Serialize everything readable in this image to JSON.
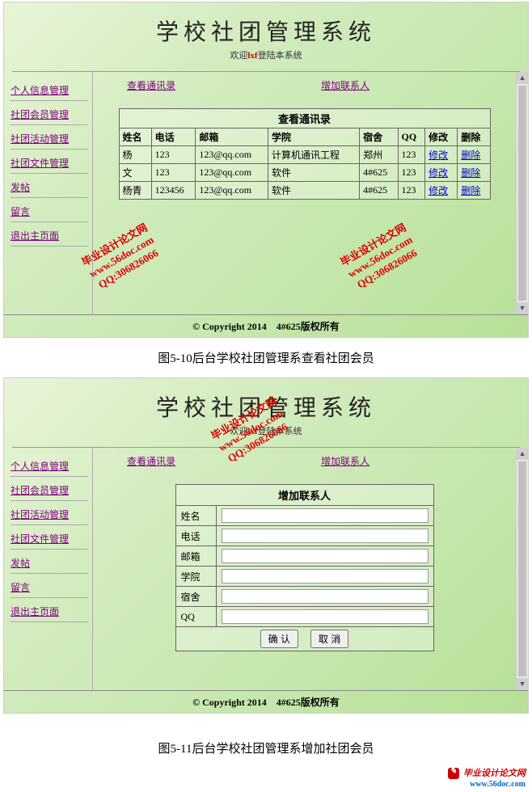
{
  "app": {
    "title": "学校社团管理系统",
    "welcome_prefix": "欢迎",
    "username": "lxf",
    "welcome_suffix": "登陆本系统"
  },
  "sidebar": {
    "items": [
      {
        "label": "个人信息管理"
      },
      {
        "label": "社团会员管理"
      },
      {
        "label": "社团活动管理"
      },
      {
        "label": "社团文件管理"
      },
      {
        "label": "发帖"
      },
      {
        "label": "留言"
      },
      {
        "label": "退出主页面"
      }
    ]
  },
  "tabs": {
    "view": "查看通讯录",
    "add": "增加联系人"
  },
  "view_table": {
    "title": "查看通讯录",
    "headers": {
      "name": "姓名",
      "phone": "电话",
      "email": "邮箱",
      "college": "学院",
      "dorm": "宿舍",
      "qq": "QQ",
      "edit": "修改",
      "del": "删除"
    },
    "rows": [
      {
        "name": "杨",
        "phone": "123",
        "email": "123@qq.com",
        "college": "计算机通讯工程",
        "dorm": "郑州",
        "qq": "123",
        "edit": "修改",
        "del": "删除"
      },
      {
        "name": "文",
        "phone": "123",
        "email": "123@qq.com",
        "college": "软件",
        "dorm": "4#625",
        "qq": "123",
        "edit": "修改",
        "del": "删除"
      },
      {
        "name": "杨青",
        "phone": "123456",
        "email": "123@qq.com",
        "college": "软件",
        "dorm": "4#625",
        "qq": "123",
        "edit": "修改",
        "del": "删除"
      }
    ]
  },
  "add_form": {
    "title": "增加联系人",
    "fields": {
      "name": "姓名",
      "phone": "电话",
      "email": "邮箱",
      "college": "学院",
      "dorm": "宿舍",
      "qq": "QQ"
    },
    "submit": "确 认",
    "cancel": "取 消"
  },
  "footer": {
    "text": "© Copyright 2014　4#625版权所有"
  },
  "captions": {
    "fig1_prefix": "图5-10后台学校社团管理系查看社团会员",
    "fig2": "图5-11后台学校社团管理系增加社团会员"
  },
  "watermark": {
    "line1": "毕业设计论文网",
    "line2": "www.56doc.com",
    "line3": "QQ:306826066"
  },
  "logo": {
    "brand": "毕业设计论文网",
    "url": "www.56doc.com"
  }
}
